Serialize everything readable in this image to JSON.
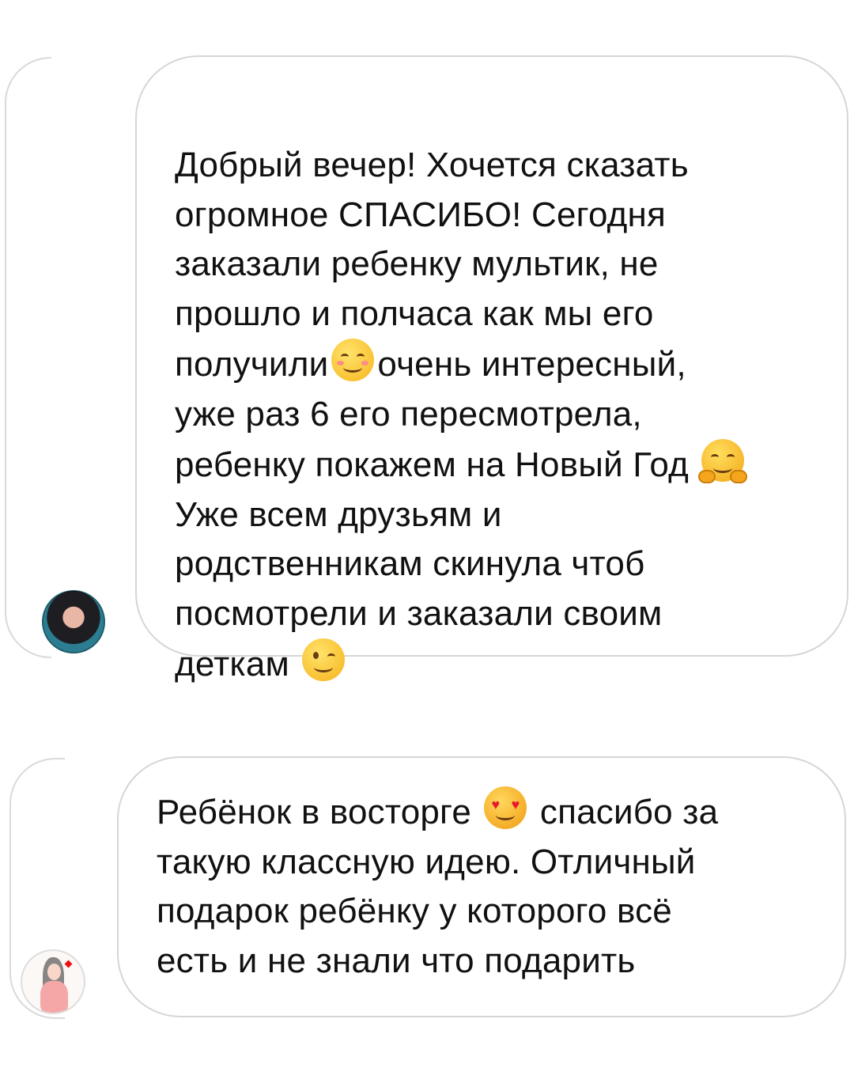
{
  "messages": [
    {
      "lines": [
        {
          "before": "Добрый вечер! Хочется сказать"
        },
        {
          "before": "огромное СПАСИБО! Сегодня"
        },
        {
          "before": "заказали ребенку мультик, не"
        },
        {
          "before": "прошло и полчаса как мы его"
        },
        {
          "before": "получили",
          "emoji": "smiling-face-emoji",
          "after": "очень интересный,"
        },
        {
          "before": "уже раз 6 его пересмотрела,"
        },
        {
          "before": "ребенку покажем на Новый Год",
          "emoji": "hugging-face-emoji"
        },
        {
          "before": "Уже всем друзьям и"
        },
        {
          "before": "родственникам скинула чтоб"
        },
        {
          "before": "посмотрели и заказали своим"
        },
        {
          "before": "деткам",
          "emoji": "winking-face-emoji"
        }
      ]
    },
    {
      "lines": [
        {
          "before": "Ребёнок в восторге",
          "emoji": "heart-eyes-emoji",
          "after": "спасибо за"
        },
        {
          "before": "такую классную идею. Отличный"
        },
        {
          "before": "подарок ребёнку у которого всё"
        },
        {
          "before": "есть и не знали что подарить"
        }
      ]
    }
  ],
  "colors": {
    "bubble_border": "#d6d6d6",
    "text": "#111111",
    "background": "#ffffff"
  }
}
